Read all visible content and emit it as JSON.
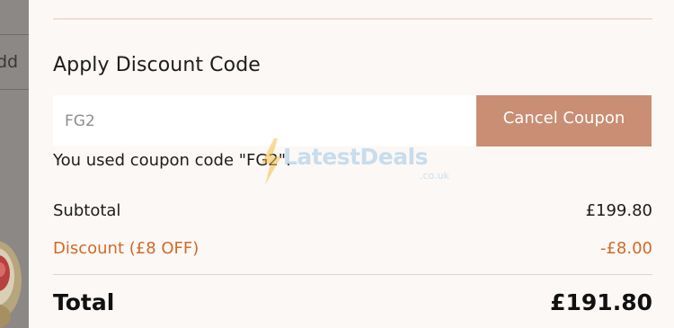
{
  "background_page": {
    "partial_text": "dd"
  },
  "discount_section": {
    "title": "Apply Discount Code",
    "coupon_value": "FG2",
    "cancel_button_label": "Cancel Coupon",
    "message": "You used coupon code \"FG2\"."
  },
  "watermark": {
    "brand": "LatestDeals",
    "sub": ".co.uk"
  },
  "summary": {
    "subtotal_label": "Subtotal",
    "subtotal_value": "£199.80",
    "discount_label": "Discount (£8 OFF)",
    "discount_value": "-£8.00",
    "total_label": "Total",
    "total_value": "£191.80"
  },
  "colors": {
    "accent_button": "#c98e74",
    "discount_text": "#d06a2a",
    "panel_bg": "#fbf8f5",
    "divider_pink": "#f3dcd7"
  }
}
